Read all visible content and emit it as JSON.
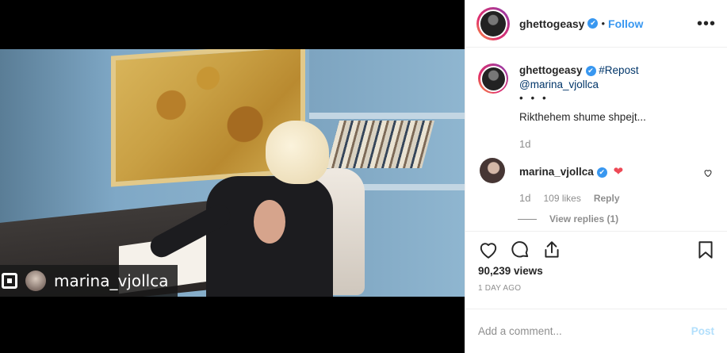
{
  "video": {
    "repost_username": "marina_vjollca"
  },
  "header": {
    "username": "ghettogeasy",
    "verified_mark": "✔",
    "separator": "•",
    "follow_label": "Follow",
    "more_label": "•••"
  },
  "caption": {
    "username": "ghettogeasy",
    "hashtag": "#Repost",
    "mention": "@marina_vjollca",
    "dots": "• • •",
    "text": "Rikthehem shume shpejt...",
    "time": "1d"
  },
  "comment": {
    "username": "marina_vjollca",
    "emoji": "❤",
    "time": "1d",
    "likes": "109 likes",
    "reply_label": "Reply",
    "view_replies": "View replies (1)"
  },
  "stats": {
    "views": "90,239 views",
    "date": "1 DAY AGO"
  },
  "add_comment": {
    "placeholder": "Add a comment...",
    "post_label": "Post"
  },
  "icons": [
    "heart-icon",
    "comment-icon",
    "share-icon",
    "bookmark-icon",
    "repost-icon",
    "verified-icon",
    "more-icon"
  ],
  "colors": {
    "accent": "#3897f0",
    "text": "#262626",
    "muted": "#8e8e8e",
    "heart": "#ed4956",
    "post_disabled": "#b2dffc"
  }
}
